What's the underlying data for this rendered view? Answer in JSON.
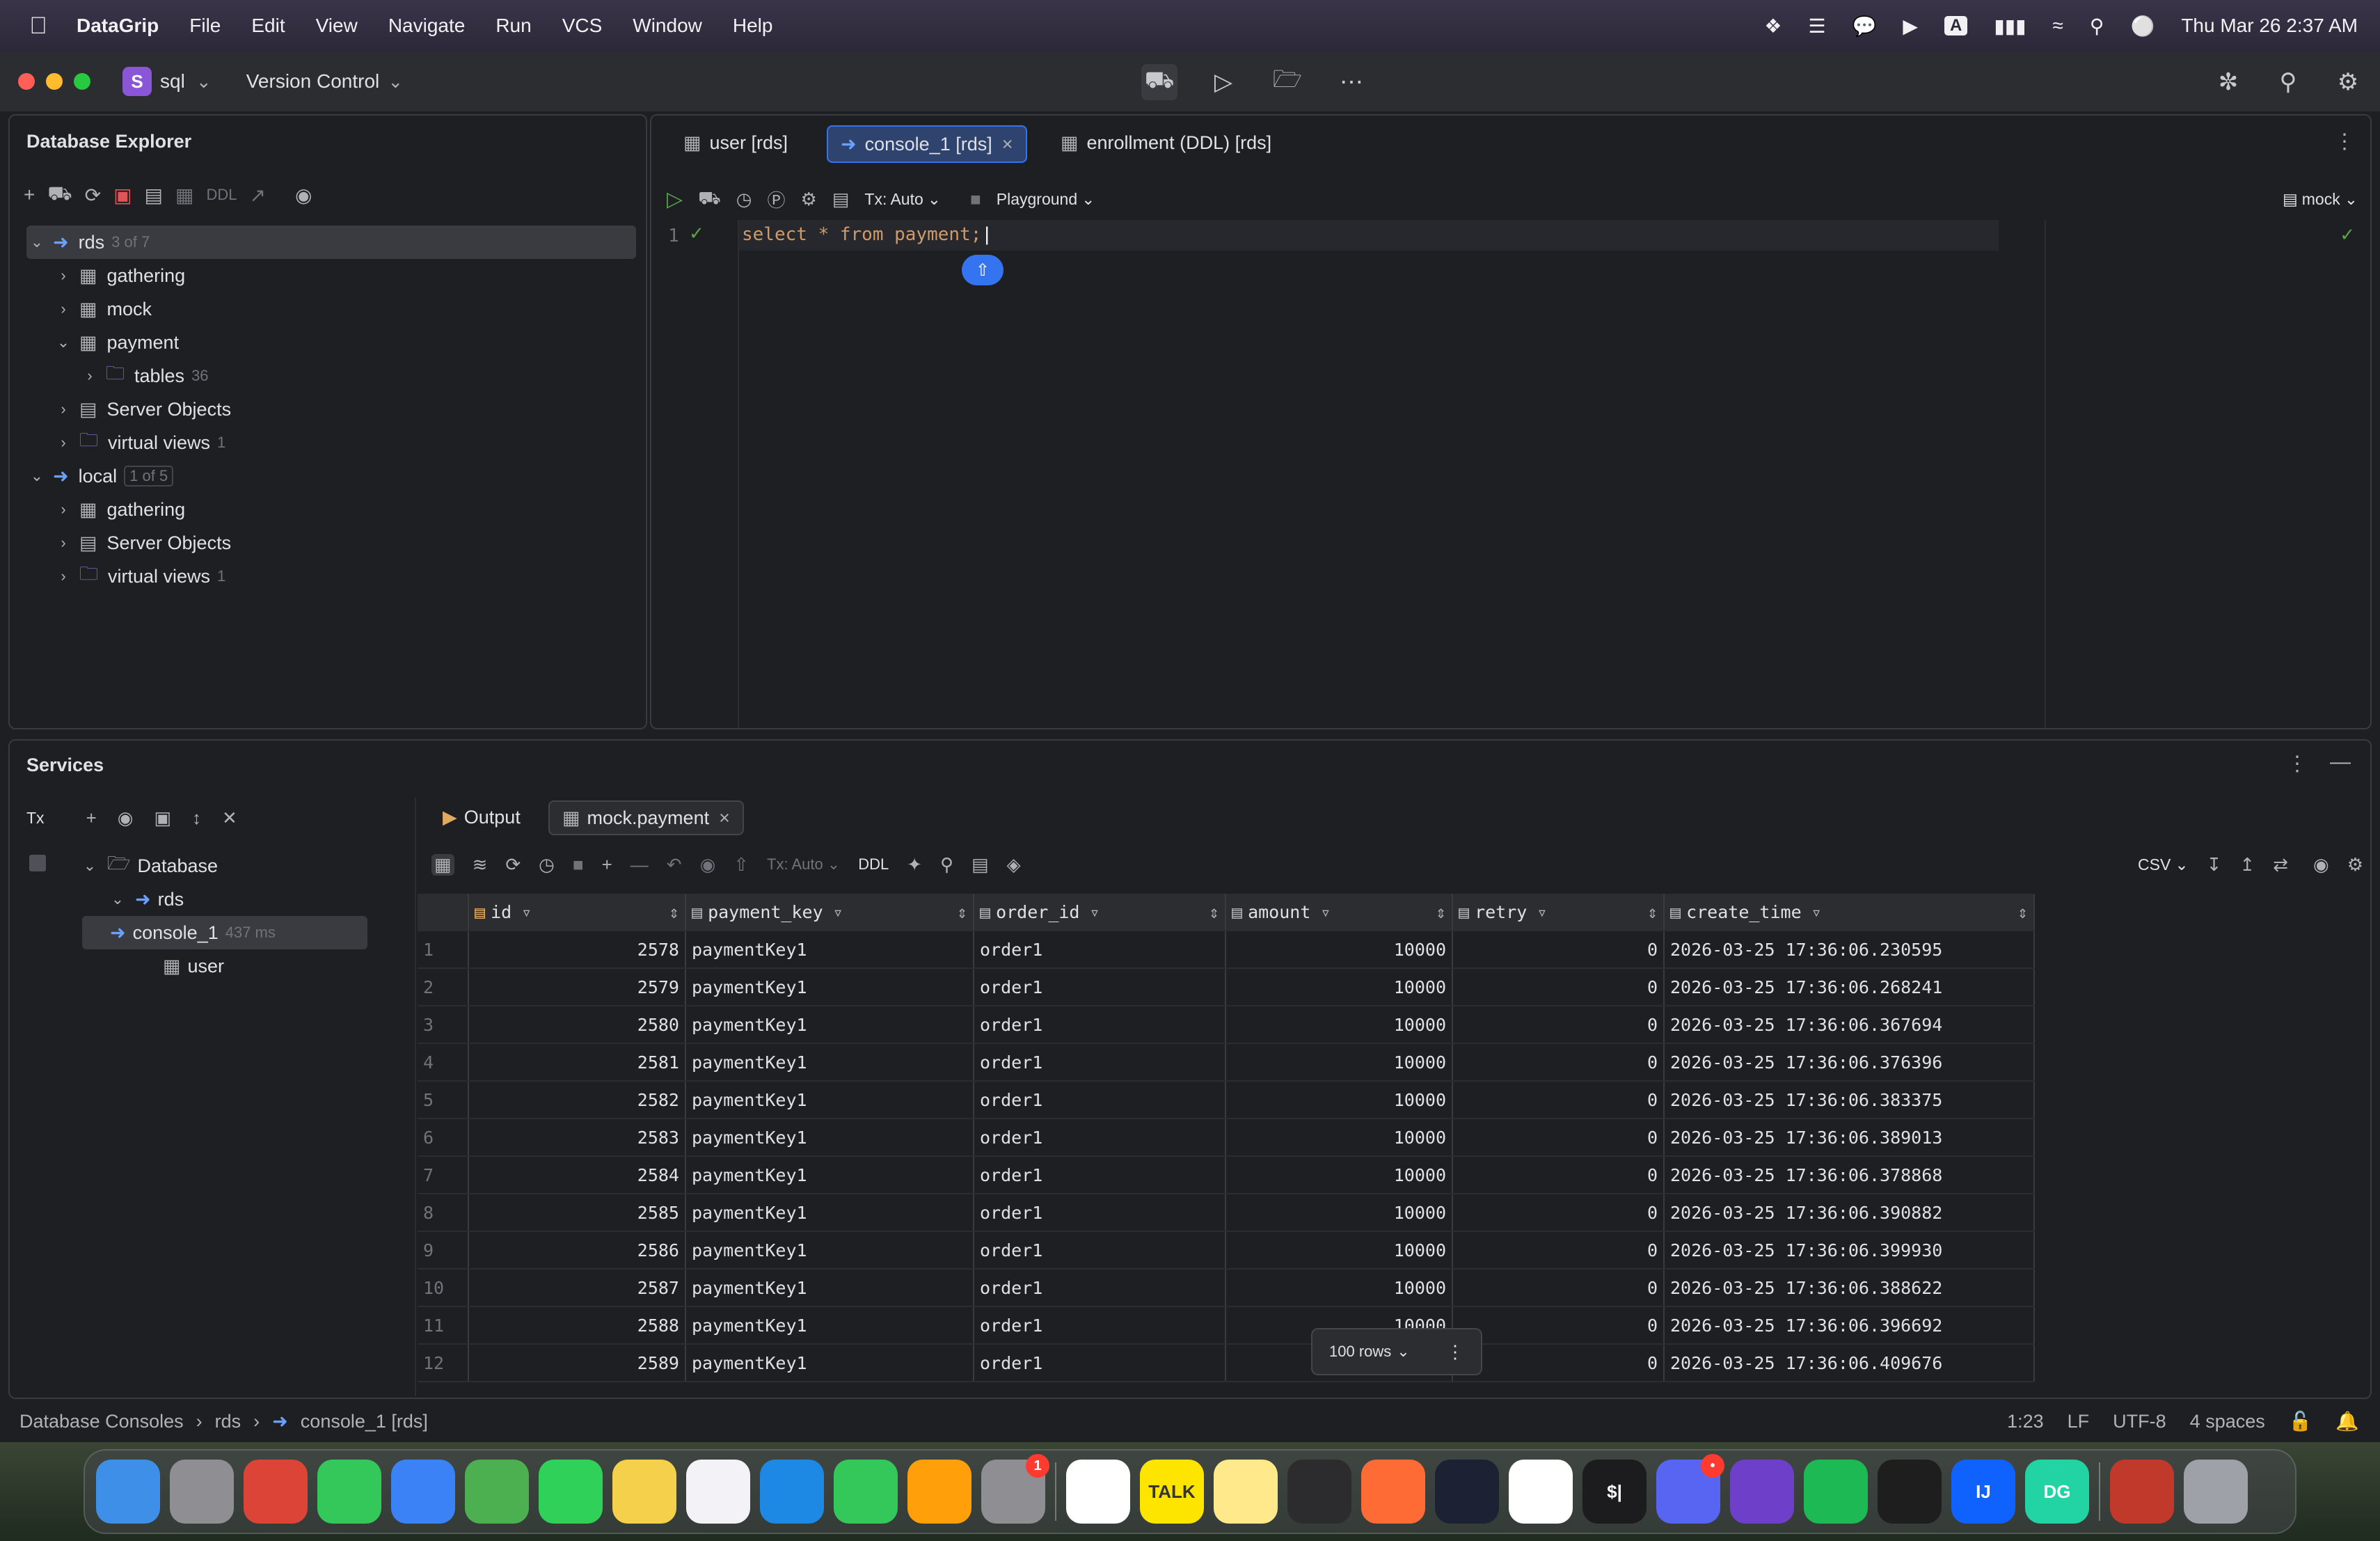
{
  "menubar": {
    "app": "DataGrip",
    "items": [
      "File",
      "Edit",
      "View",
      "Navigate",
      "Run",
      "VCS",
      "Window",
      "Help"
    ],
    "input_source": "A",
    "clock": "Thu Mar 26  2:37 AM"
  },
  "toolbar": {
    "project_letter": "S",
    "project_name": "sql",
    "vcs_label": "Version Control"
  },
  "db_explorer": {
    "title": "Database Explorer",
    "ddl_label": "DDL",
    "tree": [
      {
        "label": "rds",
        "count": "3 of 7",
        "level": 0,
        "expanded": true,
        "kind": "datasource",
        "selected": true
      },
      {
        "label": "gathering",
        "count": "",
        "level": 1,
        "expanded": false,
        "kind": "schema"
      },
      {
        "label": "mock",
        "count": "",
        "level": 1,
        "expanded": false,
        "kind": "schema"
      },
      {
        "label": "payment",
        "count": "",
        "level": 1,
        "expanded": true,
        "kind": "schema"
      },
      {
        "label": "tables",
        "count": "36",
        "level": 2,
        "expanded": false,
        "kind": "folder"
      },
      {
        "label": "Server Objects",
        "count": "",
        "level": 1,
        "expanded": false,
        "kind": "server"
      },
      {
        "label": "virtual views",
        "count": "1",
        "level": 1,
        "expanded": false,
        "kind": "folder"
      },
      {
        "label": "local",
        "count": "1 of 5",
        "level": 0,
        "expanded": true,
        "kind": "datasource"
      },
      {
        "label": "gathering",
        "count": "",
        "level": 1,
        "expanded": false,
        "kind": "schema"
      },
      {
        "label": "Server Objects",
        "count": "",
        "level": 1,
        "expanded": false,
        "kind": "server"
      },
      {
        "label": "virtual views",
        "count": "1",
        "level": 1,
        "expanded": false,
        "kind": "folder"
      }
    ]
  },
  "editor": {
    "tabs": [
      {
        "label": "user [rds]",
        "active": false
      },
      {
        "label": "console_1 [rds]",
        "active": true
      },
      {
        "label": "enrollment (DDL) [rds]",
        "active": false
      }
    ],
    "tx_label": "Tx: Auto",
    "playground_label": "Playground",
    "schema_label": "mock",
    "line_number": "1",
    "code": "select * from payment;"
  },
  "services": {
    "title": "Services",
    "tx_label": "Tx",
    "tree": [
      {
        "label": "Database",
        "level": 0
      },
      {
        "label": "rds",
        "level": 1
      },
      {
        "label": "console_1",
        "time": "437 ms",
        "level": 2,
        "selected": true
      },
      {
        "label": "user",
        "level": 2
      }
    ],
    "tabs": [
      {
        "label": "Output",
        "active": false
      },
      {
        "label": "mock.payment",
        "active": true
      }
    ],
    "grid_tx_label": "Tx: Auto",
    "grid_ddl_label": "DDL",
    "export_format": "CSV",
    "rows_label": "100 rows"
  },
  "result_grid": {
    "columns": [
      "id",
      "payment_key",
      "order_id",
      "amount",
      "retry",
      "create_time"
    ],
    "rows": [
      [
        "1",
        "2578",
        "paymentKey1",
        "order1",
        "10000",
        "0",
        "2026-03-25 17:36:06.230595"
      ],
      [
        "2",
        "2579",
        "paymentKey1",
        "order1",
        "10000",
        "0",
        "2026-03-25 17:36:06.268241"
      ],
      [
        "3",
        "2580",
        "paymentKey1",
        "order1",
        "10000",
        "0",
        "2026-03-25 17:36:06.367694"
      ],
      [
        "4",
        "2581",
        "paymentKey1",
        "order1",
        "10000",
        "0",
        "2026-03-25 17:36:06.376396"
      ],
      [
        "5",
        "2582",
        "paymentKey1",
        "order1",
        "10000",
        "0",
        "2026-03-25 17:36:06.383375"
      ],
      [
        "6",
        "2583",
        "paymentKey1",
        "order1",
        "10000",
        "0",
        "2026-03-25 17:36:06.389013"
      ],
      [
        "7",
        "2584",
        "paymentKey1",
        "order1",
        "10000",
        "0",
        "2026-03-25 17:36:06.378868"
      ],
      [
        "8",
        "2585",
        "paymentKey1",
        "order1",
        "10000",
        "0",
        "2026-03-25 17:36:06.390882"
      ],
      [
        "9",
        "2586",
        "paymentKey1",
        "order1",
        "10000",
        "0",
        "2026-03-25 17:36:06.399930"
      ],
      [
        "10",
        "2587",
        "paymentKey1",
        "order1",
        "10000",
        "0",
        "2026-03-25 17:36:06.388622"
      ],
      [
        "11",
        "2588",
        "paymentKey1",
        "order1",
        "10000",
        "0",
        "2026-03-25 17:36:06.396692"
      ],
      [
        "12",
        "2589",
        "paymentKey1",
        "order1",
        "10000",
        "0",
        "2026-03-25 17:36:06.409676"
      ]
    ]
  },
  "statusbar": {
    "breadcrumb": [
      "Database Consoles",
      "rds",
      "console_1 [rds]"
    ],
    "position": "1:23",
    "line_ending": "LF",
    "encoding": "UTF-8",
    "indent": "4 spaces"
  },
  "dock": {
    "apps": [
      {
        "name": "Finder",
        "color": "#3d8fe8",
        "label": ""
      },
      {
        "name": "Launchpad",
        "color": "#8e8e93",
        "label": ""
      },
      {
        "name": "Chrome",
        "color": "#db4437",
        "label": ""
      },
      {
        "name": "Messages",
        "color": "#34c759",
        "label": ""
      },
      {
        "name": "Mail",
        "color": "#3b82f6",
        "label": ""
      },
      {
        "name": "Maps",
        "color": "#4caf50",
        "label": ""
      },
      {
        "name": "FaceTime",
        "color": "#30d158",
        "label": ""
      },
      {
        "name": "Notes",
        "color": "#f5d04a",
        "label": ""
      },
      {
        "name": "Freeform",
        "color": "#f2f2f7",
        "label": ""
      },
      {
        "name": "Keynote",
        "color": "#1e88e5",
        "label": ""
      },
      {
        "name": "Numbers",
        "color": "#34c759",
        "label": ""
      },
      {
        "name": "Pages",
        "color": "#ff9f0a",
        "label": ""
      },
      {
        "name": "System Settings",
        "color": "#8e8e93",
        "label": "",
        "badge": "1"
      },
      {
        "name": "Slack",
        "color": "#ffffff",
        "label": ""
      },
      {
        "name": "KakaoTalk",
        "color": "#fee500",
        "label": "TALK"
      },
      {
        "name": "Stickies",
        "color": "#ffe98a",
        "label": ""
      },
      {
        "name": "Activity Monitor",
        "color": "#2c2c2e",
        "label": ""
      },
      {
        "name": "Pencil",
        "color": "#ff6b35",
        "label": ""
      },
      {
        "name": "ChatGPT",
        "color": "#1c2233",
        "label": ""
      },
      {
        "name": "VS Code",
        "color": "#ffffff",
        "label": ""
      },
      {
        "name": "Terminal",
        "color": "#1c1c1e",
        "label": "$|"
      },
      {
        "name": "Discord",
        "color": "#5865f2",
        "label": "",
        "badge": "•"
      },
      {
        "name": "GitHub",
        "color": "#6e40c9",
        "label": ""
      },
      {
        "name": "Spotify",
        "color": "#1db954",
        "label": ""
      },
      {
        "name": "Figma",
        "color": "#1e1e1e",
        "label": ""
      },
      {
        "name": "IntelliJ IDEA",
        "color": "#0f62fe",
        "label": "IJ"
      },
      {
        "name": "DataGrip",
        "color": "#22d3a4",
        "label": "DG"
      },
      {
        "name": "Preview",
        "color": "#c0392b",
        "label": ""
      },
      {
        "name": "Trash",
        "color": "#9ea2a8",
        "label": ""
      }
    ]
  }
}
